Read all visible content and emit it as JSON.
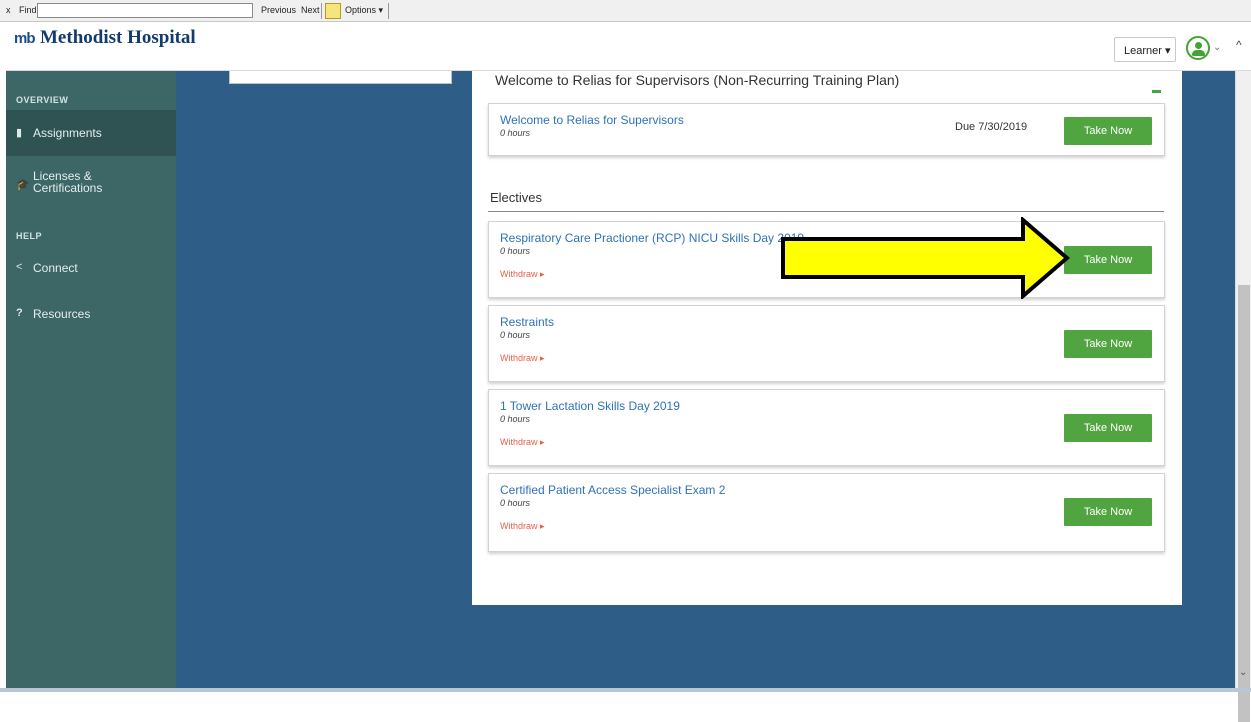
{
  "findbar": {
    "close": "x",
    "label": "Find:",
    "value": "",
    "previous": "Previous",
    "next": "Next",
    "options": "Options ▾"
  },
  "header": {
    "logo_mark": "mb",
    "logo_text": "Methodist Hospital",
    "role_menu": "Learner ▾",
    "avatar_chevron": "⌄",
    "scroll_up": "^"
  },
  "sidebar": {
    "overview_heading": "OVERVIEW",
    "help_heading": "HELP",
    "items": [
      {
        "icon": "▮",
        "label": "Assignments"
      },
      {
        "icon": "🎓",
        "label": "Licenses & Certifications"
      },
      {
        "icon": "<",
        "label": "Connect"
      },
      {
        "icon": "?",
        "label": "Resources"
      }
    ]
  },
  "plan": {
    "title": "Welcome to Relias for Supervisors (Non-Recurring Training Plan)"
  },
  "required_card": {
    "title": "Welcome to Relias for Supervisors",
    "hours": "0 hours",
    "due": "Due 7/30/2019",
    "button": "Take Now"
  },
  "electives": {
    "heading": "Electives",
    "cards": [
      {
        "title": "Respiratory Care Practioner (RCP) NICU Skills Day 2019",
        "hours": "0 hours",
        "withdraw": "Withdraw ▸",
        "button": "Take Now"
      },
      {
        "title": "Restraints",
        "hours": "0 hours",
        "withdraw": "Withdraw ▸",
        "button": "Take Now"
      },
      {
        "title": "1 Tower Lactation Skills Day 2019",
        "hours": "0 hours",
        "withdraw": "Withdraw ▸",
        "button": "Take Now"
      },
      {
        "title": "Certified Patient Access Specialist Exam 2",
        "hours": "0 hours",
        "withdraw": "Withdraw ▸",
        "button": "Take Now"
      }
    ]
  },
  "scrollbar": {
    "down": "⌄"
  },
  "colors": {
    "sidebar": "#3d6666",
    "main_background": "#2e5e87",
    "button_green": "#51a540",
    "link_blue": "#2f72b8",
    "withdraw_red": "#e4624a",
    "annotation_arrow": "#ffff00"
  }
}
